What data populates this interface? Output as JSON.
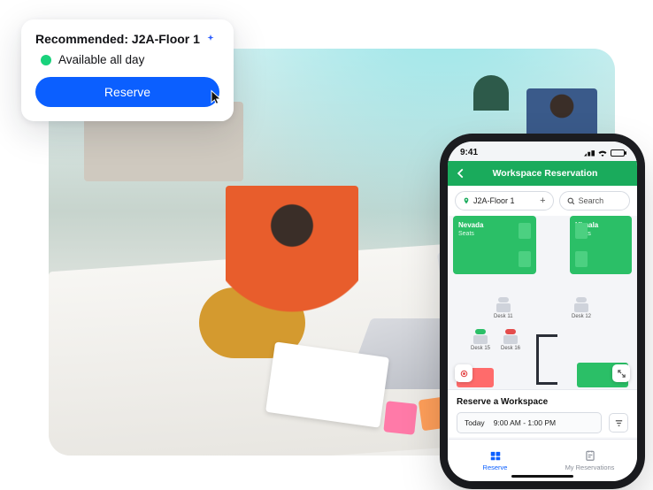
{
  "rec_card": {
    "title": "Recommended: J2A-Floor 1",
    "availability": "Available all day",
    "button": "Reserve"
  },
  "phone": {
    "status_time": "9:41",
    "header_title": "Workspace Reservation",
    "location_pill": "J2A-Floor 1",
    "search_placeholder": "Search",
    "rooms": {
      "nevada": {
        "name": "Nevada",
        "sub": "Seats"
      },
      "himalaya": {
        "name": "Himala",
        "sub": "Seats"
      }
    },
    "desks": {
      "d11": "Desk 11",
      "d12": "Desk 12",
      "d15": "Desk 15",
      "d16": "Desk 16"
    },
    "reserve_panel": {
      "title": "Reserve a Workspace",
      "day": "Today",
      "time": "9:00 AM - 1:00 PM"
    },
    "tabs": {
      "reserve": "Reserve",
      "my": "My Reservations"
    }
  }
}
